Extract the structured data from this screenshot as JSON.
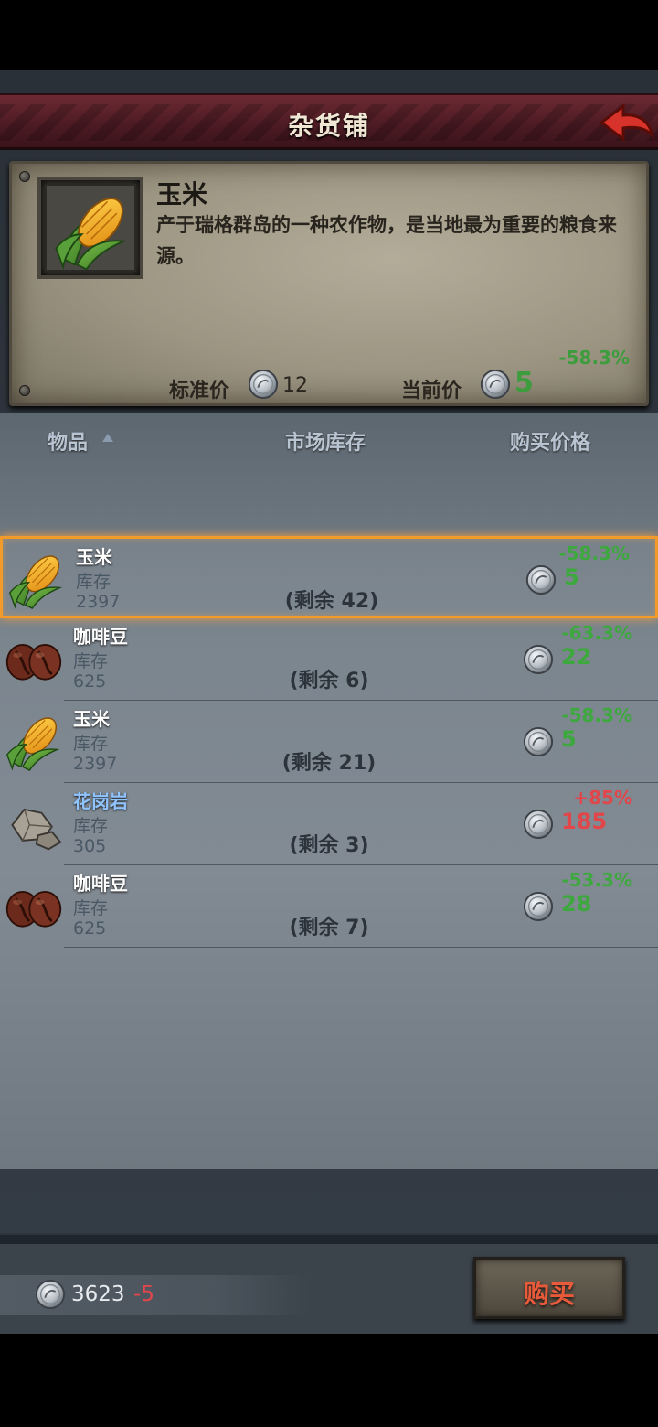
{
  "header": {
    "title": "杂货铺"
  },
  "detail": {
    "name": "玉米",
    "description": "产于瑞格群岛的一种农作物，是当地最为重要的粮食来源。",
    "price_change": "-58.3%",
    "standard_price_label": "标准价",
    "standard_price": "12",
    "current_price_label": "当前价",
    "current_price": "5"
  },
  "columns": {
    "item": "物品",
    "market_stock": "市场库存",
    "buy_price": "购买价格"
  },
  "items": [
    {
      "name": "玉米",
      "stock_label": "库存",
      "stock": "2397",
      "remaining": "(剩余 42)",
      "price_change": "-58.3%",
      "price": "5",
      "icon": "corn-icon"
    },
    {
      "name": "咖啡豆",
      "stock_label": "库存",
      "stock": "625",
      "remaining": "(剩余 6)",
      "price_change": "-63.3%",
      "price": "22",
      "icon": "coffee-beans-icon"
    },
    {
      "name": "玉米",
      "stock_label": "库存",
      "stock": "2397",
      "remaining": "(剩余 21)",
      "price_change": "-58.3%",
      "price": "5",
      "icon": "corn-icon"
    },
    {
      "name": "花岗岩",
      "stock_label": "库存",
      "stock": "305",
      "remaining": "(剩余 3)",
      "price_change": "+85%",
      "price": "185",
      "icon": "granite-icon"
    },
    {
      "name": "咖啡豆",
      "stock_label": "库存",
      "stock": "625",
      "remaining": "(剩余 7)",
      "price_change": "-53.3%",
      "price": "28",
      "icon": "coffee-beans-icon"
    }
  ],
  "footer": {
    "money": "3623",
    "money_delta": "-5",
    "buy_label": "购买"
  },
  "colors": {
    "price_down": "#3da83d",
    "price_up": "#e0464a",
    "selection": "#f29a2a"
  }
}
